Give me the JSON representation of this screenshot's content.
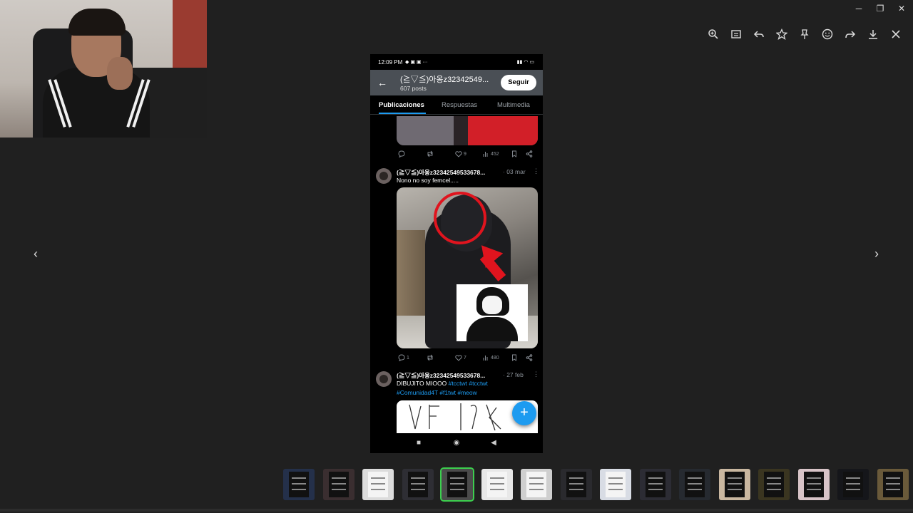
{
  "window": {
    "minimize_glyph": "─",
    "restore_glyph": "❐",
    "close_glyph": "✕"
  },
  "toolbar": {
    "icons": [
      "zoom-in-icon",
      "info-icon",
      "undo-icon",
      "star-icon",
      "pin-icon",
      "emoji-icon",
      "share-icon",
      "download-icon",
      "close-icon"
    ]
  },
  "viewer": {
    "prev_glyph": "‹",
    "next_glyph": "›"
  },
  "phone": {
    "status": {
      "time": "12:09 PM",
      "icons": "◆ ▣ ▣ ···",
      "right": "▮▮ ◠ ▭"
    },
    "profile": {
      "title": "(≧▽≦)아옹z32342549...",
      "posts": "607 posts",
      "follow_label": "Seguir",
      "back_glyph": "←"
    },
    "tabs": [
      "Publicaciones",
      "Respuestas",
      "Multimedia"
    ],
    "prev_post_actions": {
      "replies": "",
      "reposts": "",
      "likes": "9",
      "views": "452"
    },
    "post1": {
      "author": "(≧▽≦)아옹z32342549533678...",
      "date": "· 03 mar",
      "more": "⋮",
      "text": "Nono no soy femcel.....",
      "actions": {
        "replies": "1",
        "reposts": "",
        "likes": "7",
        "views": "480"
      }
    },
    "post2": {
      "author": "(≧▽≦)아옹z32342549533678...",
      "date": "· 27 feb",
      "more": "⋮",
      "text_line1": "DIBUJITO MIOOO",
      "hashtags_line1": "#tcctwt #tcctwt",
      "hashtags_line2": "#Comunidad4T #f1twt #meow"
    },
    "fab_glyph": "+",
    "nav": {
      "square": "■",
      "circle": "◉",
      "back": "◀"
    }
  },
  "filmstrip": {
    "count": 16,
    "selected_index": 4
  },
  "colors": {
    "accent": "#1d9bf0",
    "annotation_red": "#e0141e",
    "selected_thumb": "#3ccf4e"
  }
}
